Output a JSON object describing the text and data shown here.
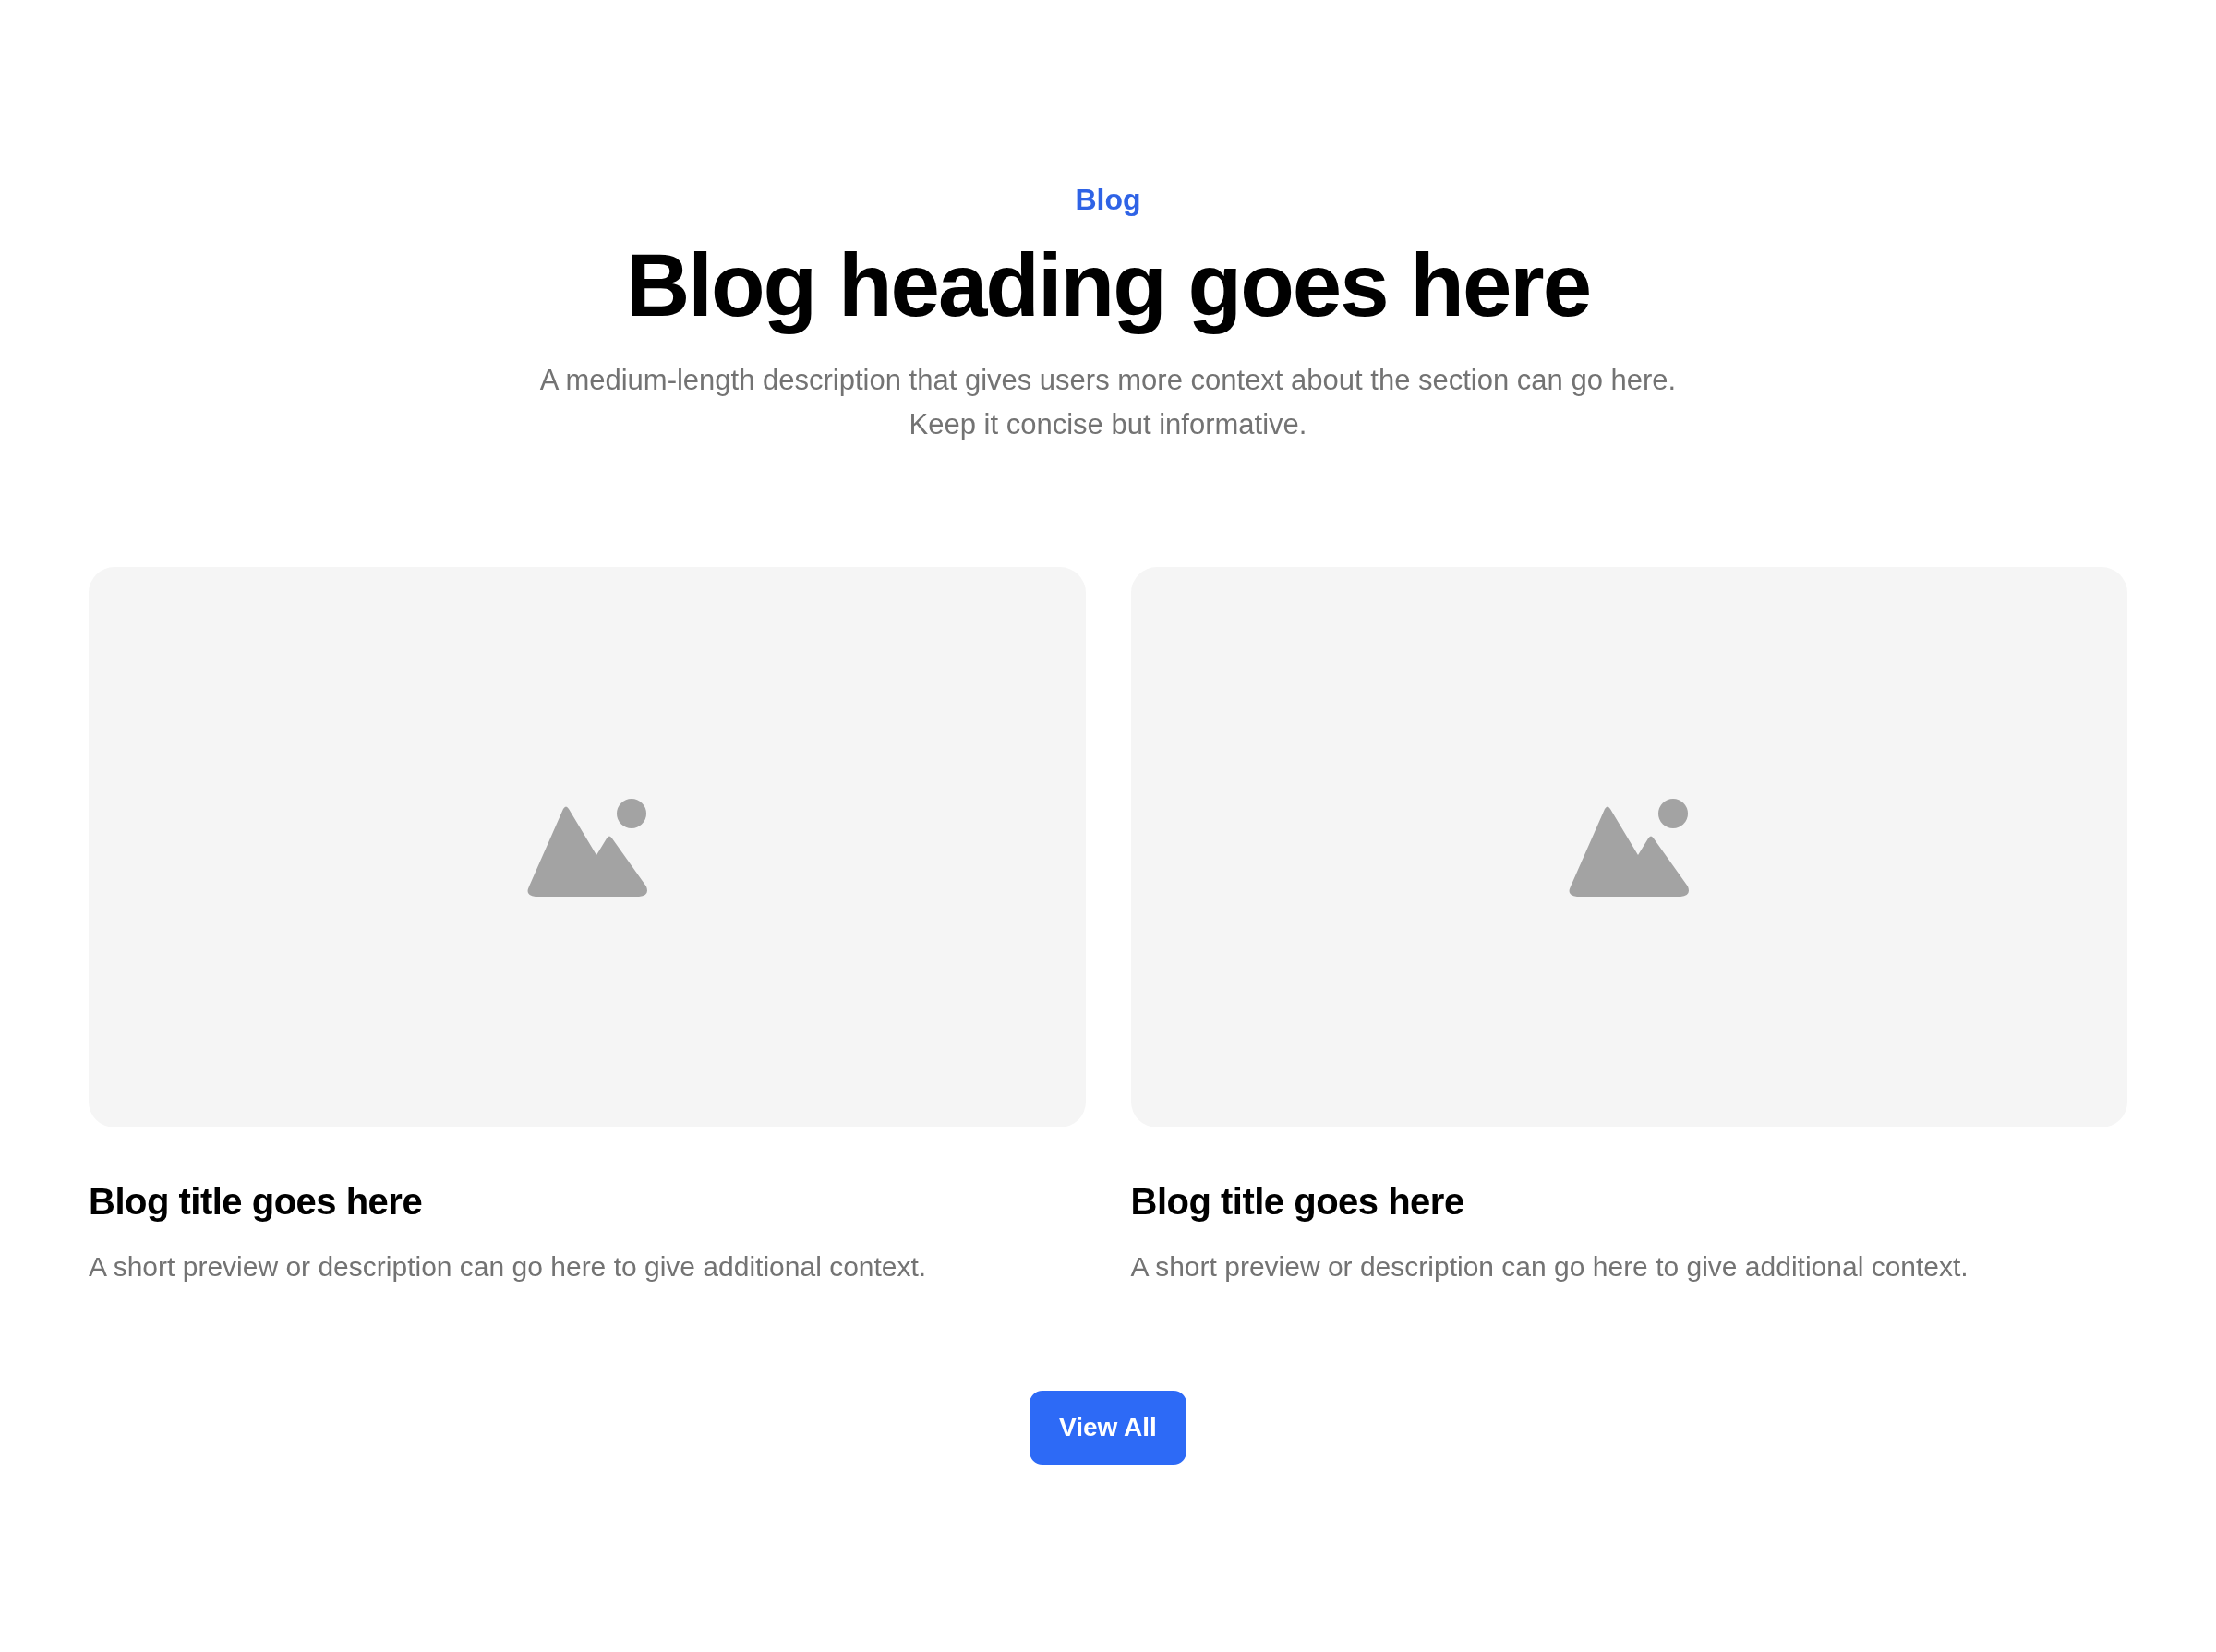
{
  "tagline": "Blog",
  "heading": "Blog heading goes here",
  "description": "A medium-length description that gives users more context about the section can go here. Keep it concise but informative.",
  "posts": [
    {
      "title": "Blog title goes here",
      "excerpt": "A short preview or description can go here to give additional context."
    },
    {
      "title": "Blog title goes here",
      "excerpt": "A short preview or description can go here to give additional context."
    }
  ],
  "button": "View All"
}
